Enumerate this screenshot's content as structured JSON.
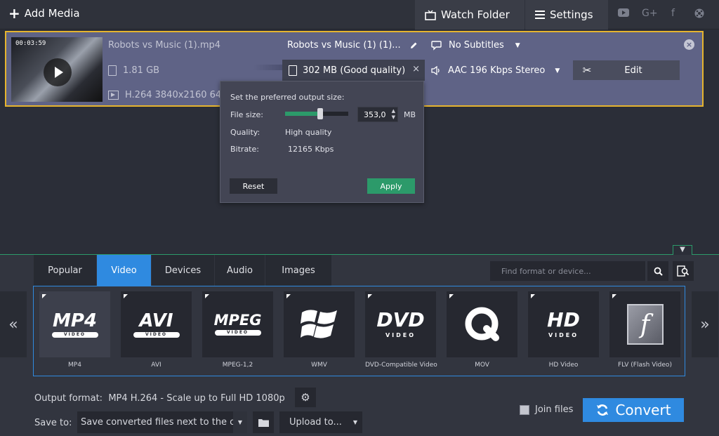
{
  "toolbar": {
    "add_media": "Add Media",
    "watch_folder": "Watch Folder",
    "settings": "Settings",
    "social": [
      "youtube-icon",
      "google-plus-icon",
      "facebook-icon",
      "vk-icon"
    ],
    "google_plus": "G+",
    "facebook": "f"
  },
  "file": {
    "duration": "00:03:59",
    "name": "Robots vs Music (1).mp4",
    "size": "1.81 GB",
    "codec": "H.264 3840x2160 64",
    "output_name": "Robots vs Music (1) (1)...",
    "output_size": "302 MB (Good quality)",
    "subtitles": "No Subtitles",
    "audio": "AAC 196 Kbps Stereo",
    "edit": "Edit"
  },
  "popup": {
    "title": "Set the preferred output size:",
    "file_size_label": "File size:",
    "file_size_value": "353,0",
    "unit": "MB",
    "slider_fraction": 0.55,
    "quality_label": "Quality:",
    "quality_value": "High quality",
    "bitrate_label": "Bitrate:",
    "bitrate_value": "12165 Kbps",
    "reset": "Reset",
    "apply": "Apply"
  },
  "tabs": [
    {
      "label": "Popular",
      "active": false
    },
    {
      "label": "Video",
      "active": true
    },
    {
      "label": "Devices",
      "active": false
    },
    {
      "label": "Audio",
      "active": false
    },
    {
      "label": "Images",
      "active": false
    }
  ],
  "search": {
    "placeholder": "Find format or device..."
  },
  "formats": [
    {
      "name": "MP4",
      "logo": "MP4",
      "sub": "VIDEO",
      "selected": true
    },
    {
      "name": "AVI",
      "logo": "AVI",
      "sub": "VIDEO",
      "selected": false
    },
    {
      "name": "MPEG-1,2",
      "logo": "MPEG",
      "sub": "VIDEO",
      "selected": false
    },
    {
      "name": "WMV",
      "logo": "",
      "sub": "",
      "selected": false
    },
    {
      "name": "DVD-Compatible Video",
      "logo": "DVD",
      "sub": "VIDEO",
      "selected": false
    },
    {
      "name": "MOV",
      "logo": "Q",
      "sub": "",
      "selected": false
    },
    {
      "name": "HD Video",
      "logo": "HD",
      "sub": "VIDEO",
      "selected": false
    },
    {
      "name": "FLV (Flash Video)",
      "logo": "f",
      "sub": "",
      "selected": false
    }
  ],
  "nav": {
    "prev": "«",
    "next": "»"
  },
  "output": {
    "format_label": "Output format:",
    "format_value": "MP4 H.264 - Scale up to Full HD 1080p",
    "save_label": "Save to:",
    "save_value": "Save converted files next to the c",
    "upload": "Upload to...",
    "join": "Join files",
    "convert": "Convert"
  },
  "colors": {
    "accent": "#2f8ae0",
    "green": "#2c9a6a",
    "card": "#5f6386",
    "highlight": "#e6b42e"
  }
}
